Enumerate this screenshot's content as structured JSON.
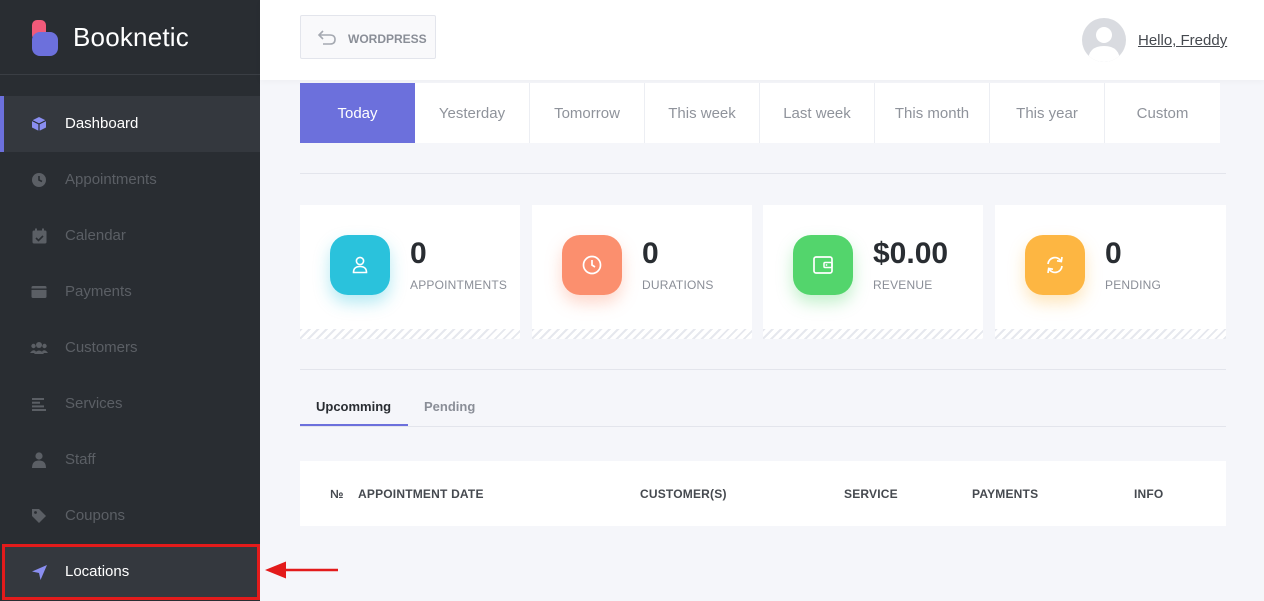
{
  "app": {
    "name": "Booknetic",
    "brand_color": "#6c70dc",
    "accent_pink": "#f15a7a"
  },
  "sidebar": {
    "items": [
      {
        "label": "Dashboard",
        "icon": "cube-icon",
        "state": "active"
      },
      {
        "label": "Appointments",
        "icon": "clock-icon",
        "state": "normal"
      },
      {
        "label": "Calendar",
        "icon": "calendar-check-icon",
        "state": "normal"
      },
      {
        "label": "Payments",
        "icon": "wallet-icon",
        "state": "normal"
      },
      {
        "label": "Customers",
        "icon": "users-icon",
        "state": "normal"
      },
      {
        "label": "Services",
        "icon": "list-icon",
        "state": "normal"
      },
      {
        "label": "Staff",
        "icon": "user-icon",
        "state": "normal"
      },
      {
        "label": "Coupons",
        "icon": "tag-icon",
        "state": "normal"
      },
      {
        "label": "Locations",
        "icon": "location-arrow-icon",
        "state": "highlighted"
      }
    ]
  },
  "header": {
    "back_label": "WORDPRESS",
    "greeting": "Hello, Freddy"
  },
  "periods": {
    "items": [
      "Today",
      "Yesterday",
      "Tomorrow",
      "This week",
      "Last week",
      "This month",
      "This year",
      "Custom"
    ],
    "selected": "Today"
  },
  "stats": [
    {
      "value": "0",
      "label": "APPOINTMENTS",
      "icon": "user-icon",
      "color": "#2ac2dc"
    },
    {
      "value": "0",
      "label": "DURATIONS",
      "icon": "clock-icon",
      "color": "#fb8f6e"
    },
    {
      "value": "$0.00",
      "label": "REVENUE",
      "icon": "wallet-icon",
      "color": "#53d56c"
    },
    {
      "value": "0",
      "label": "PENDING",
      "icon": "sync-icon",
      "color": "#fdb642"
    }
  ],
  "appointments_tabs": {
    "items": [
      "Upcomming",
      "Pending"
    ],
    "selected": "Upcomming"
  },
  "table": {
    "columns": [
      "№",
      "APPOINTMENT DATE",
      "CUSTOMER(S)",
      "SERVICE",
      "PAYMENTS",
      "INFO"
    ]
  },
  "annotation": {
    "color": "#e31b1b"
  }
}
